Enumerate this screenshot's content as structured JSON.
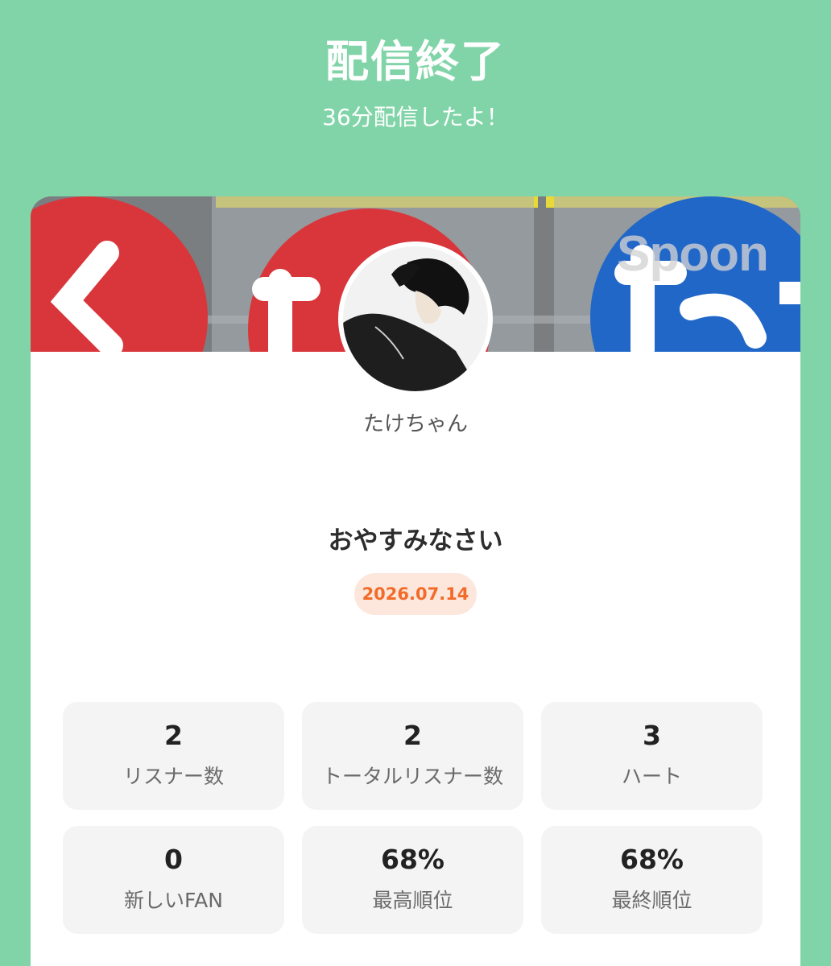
{
  "header": {
    "title": "配信終了",
    "subtitle": "36分配信したよ！"
  },
  "banner": {
    "logo_text": "Spoon"
  },
  "profile": {
    "username": "たけちゃん"
  },
  "broadcast": {
    "title": "おやすみなさい",
    "date": "2026.07.14"
  },
  "stats": [
    {
      "value": "2",
      "label": "リスナー数"
    },
    {
      "value": "2",
      "label": "トータルリスナー数"
    },
    {
      "value": "3",
      "label": "ハート"
    },
    {
      "value": "0",
      "label": "新しいFAN"
    },
    {
      "value": "68%",
      "label": "最高順位"
    },
    {
      "value": "68%",
      "label": "最終順位"
    }
  ],
  "colors": {
    "background": "#81d4a8",
    "date_badge_text": "#f26b28",
    "date_badge_bg": "#fde6dc"
  }
}
